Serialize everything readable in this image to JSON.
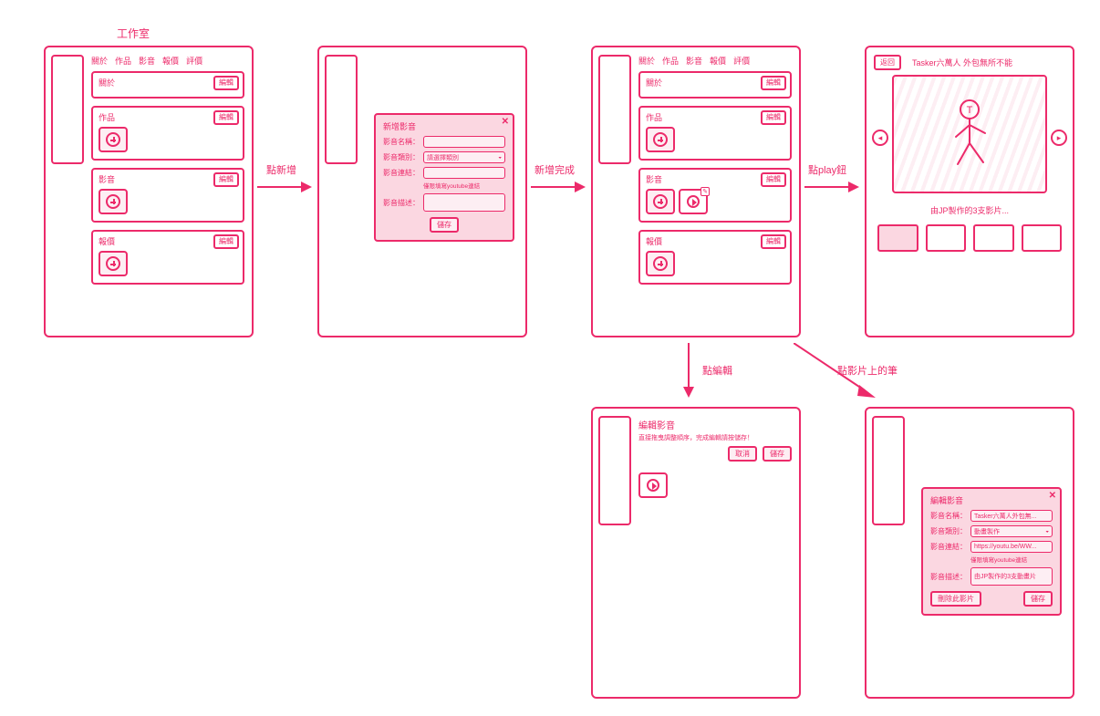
{
  "page_title": "工作室",
  "tabs": [
    "關於",
    "作品",
    "影音",
    "報價",
    "評價"
  ],
  "sections": {
    "about": "關於",
    "works": "作品",
    "video": "影音",
    "price": "報價"
  },
  "buttons": {
    "edit": "編輯",
    "save": "儲存",
    "cancel": "取消",
    "back": "返回",
    "delete_video": "刪除此影片"
  },
  "arrows": {
    "click_add": "點新增",
    "add_done": "新增完成",
    "click_play": "點play鈕",
    "click_edit": "點編輯",
    "click_pencil": "點影片上的筆"
  },
  "modal_add": {
    "title": "新增影音",
    "fields": {
      "name": "影音名稱：",
      "category": "影音類別：",
      "link": "影音連結：",
      "desc": "影音描述："
    },
    "category_placeholder": "請選擇類別",
    "link_hint": "僅限填寫youtube連結"
  },
  "modal_edit": {
    "title": "編輯影音",
    "fields": {
      "name": "影音名稱：",
      "category": "影音類別：",
      "link": "影音連結：",
      "desc": "影音描述："
    },
    "values": {
      "name": "Tasker六萬人外包無...",
      "category": "動畫製作",
      "link": "https://youtu.be/WW...",
      "desc": "由JP製作的3支動畫片"
    },
    "link_hint": "僅限填寫youtube連結"
  },
  "edit_list": {
    "title": "編輯影音",
    "subtitle": "直接拖曳調整順序，完成編輯請按儲存！"
  },
  "player": {
    "title": "Tasker六萬人 外包無所不能",
    "caption": "由JP製作的3支影片..."
  }
}
